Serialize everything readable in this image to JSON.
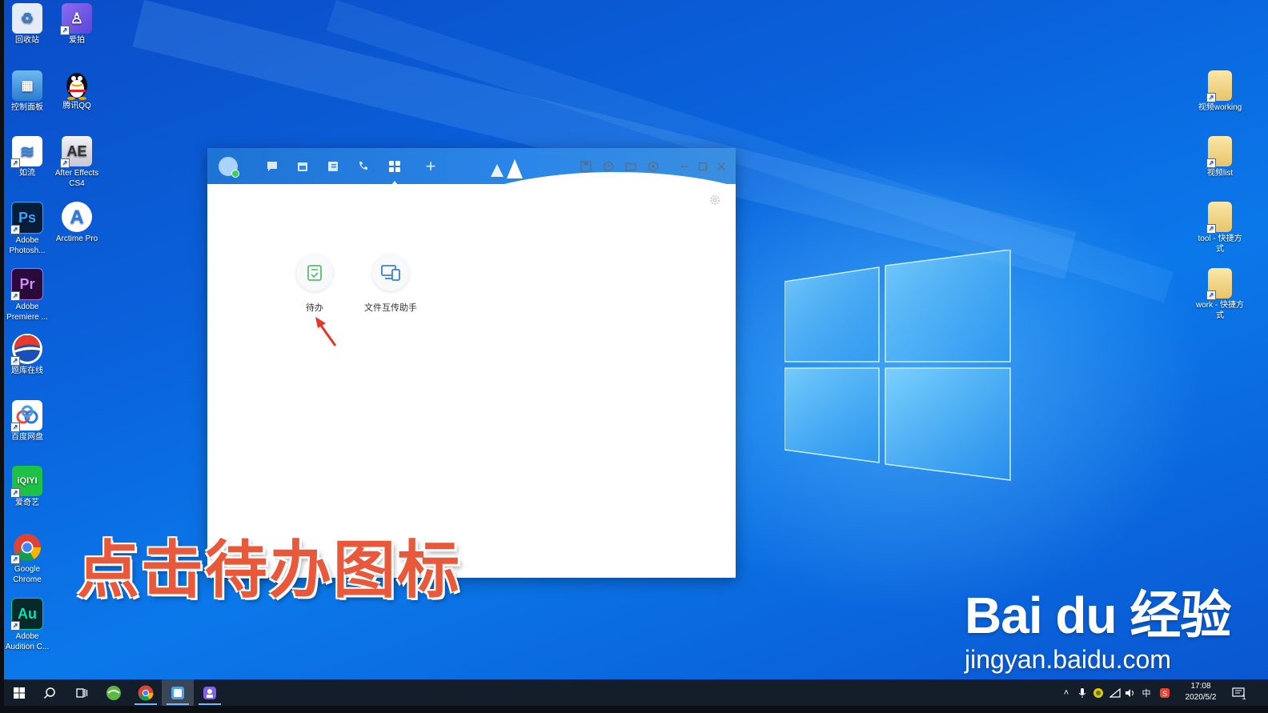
{
  "desktop": {
    "left_icons": [
      {
        "label": "回收站",
        "color": "#dfe9f5",
        "glyph": "♻"
      },
      {
        "label": "爱拍",
        "color": "#7e62e8",
        "glyph": "A"
      },
      {
        "label": "控制面板",
        "color": "#3b8fd8",
        "glyph": "▦"
      },
      {
        "label": "腾讯QQ",
        "color": "#111111",
        "glyph": "Q"
      },
      {
        "label": "如流",
        "color": "#ffffff",
        "glyph": "≋"
      },
      {
        "label": "After Effects CS4",
        "color": "#e8e8f0",
        "glyph": "AE"
      },
      {
        "label": "Adobe Photosh...",
        "color": "#0b2a4a",
        "glyph": "Ps"
      },
      {
        "label": "Arctime Pro",
        "color": "#ffffff",
        "glyph": "A"
      },
      {
        "label": "Adobe Premiere ...",
        "color": "#2a0a3a",
        "glyph": "Pr"
      },
      {
        "label": "题库在线",
        "color": "#ffffff",
        "glyph": "◐"
      },
      {
        "label": "百度网盘",
        "color": "#ffffff",
        "glyph": "✿"
      },
      {
        "label": "爱奇艺",
        "color": "#1fc046",
        "glyph": "iQIYI"
      },
      {
        "label": "Google Chrome",
        "color": "#ffffff",
        "glyph": "◉"
      },
      {
        "label": "Adobe Audition C...",
        "color": "#0a2a2a",
        "glyph": "Au"
      }
    ],
    "right_icons": [
      {
        "label": "视频working"
      },
      {
        "label": "视频list"
      },
      {
        "label": "tool - 快捷方式"
      },
      {
        "label": "work - 快捷方式"
      }
    ]
  },
  "app": {
    "toolbar": [
      "chat",
      "calendar",
      "document",
      "phone",
      "apps",
      "add"
    ],
    "toolbar_right": [
      "save",
      "history",
      "folder",
      "settings"
    ],
    "tiles": [
      {
        "label": "待办"
      },
      {
        "label": "文件互传助手"
      }
    ]
  },
  "overlay": {
    "caption": "点击待办图标"
  },
  "watermark": {
    "logo": "Bai du 经验",
    "url": "jingyan.baidu.com"
  },
  "taskbar": {
    "time": "17:08",
    "date": "2020/5/2",
    "ime": "中",
    "notification_count": "1"
  },
  "colors": {
    "accent": "#2a86e8",
    "caption": "#e8583a",
    "todo_green": "#5bbf72",
    "file_blue": "#3a7fe0"
  }
}
